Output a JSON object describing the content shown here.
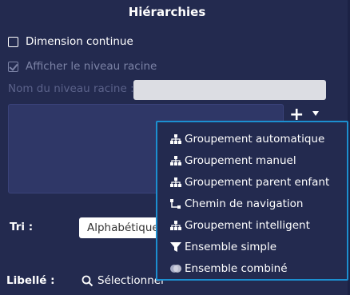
{
  "panel": {
    "title": "Hiérarchies",
    "continuous_dimension": {
      "label": "Dimension continue",
      "checked": false
    },
    "show_root_level": {
      "label": "Afficher le niveau racine",
      "checked": true,
      "disabled": true
    },
    "root_level_name": {
      "label": "Nom du niveau racine :",
      "value": ""
    },
    "sort": {
      "label": "Tri :",
      "selected": "Alphabétique"
    },
    "label_field": {
      "label": "Libellé :",
      "action": "Sélectionner"
    }
  },
  "add_menu": {
    "items": [
      {
        "label": "Groupement automatique",
        "icon": "hierarchy-icon"
      },
      {
        "label": "Groupement manuel",
        "icon": "hierarchy-icon"
      },
      {
        "label": "Groupement parent enfant",
        "icon": "hierarchy-icon"
      },
      {
        "label": "Chemin de navigation",
        "icon": "navigation-path-icon"
      },
      {
        "label": "Groupement intelligent",
        "icon": "hierarchy-icon"
      },
      {
        "label": "Ensemble simple",
        "icon": "funnel-set-icon"
      },
      {
        "label": "Ensemble combiné",
        "icon": "combined-set-icon"
      }
    ]
  },
  "colors": {
    "background": "#232a4f",
    "menu_border": "#1c8fd0",
    "disabled_text": "#7c83a6"
  }
}
